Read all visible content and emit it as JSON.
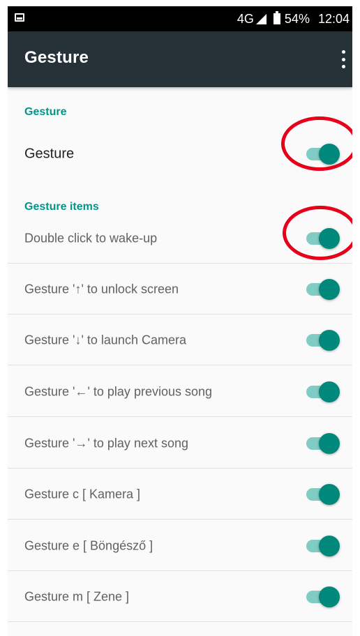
{
  "status_bar": {
    "network": "4G",
    "battery": "54%",
    "time": "12:04"
  },
  "app_bar": {
    "title": "Gesture"
  },
  "sections": {
    "gesture_header": "Gesture",
    "items_header": "Gesture items"
  },
  "rows": [
    {
      "label": "Gesture",
      "on": true
    },
    {
      "label": "Double click to wake-up",
      "on": true
    },
    {
      "label": "Gesture '↑' to unlock screen",
      "on": true
    },
    {
      "label": "Gesture '↓' to launch Camera",
      "on": true
    },
    {
      "label": "Gesture '←' to play previous song",
      "on": true
    },
    {
      "label": "Gesture '→' to play next song",
      "on": true
    },
    {
      "label": "Gesture c [ Kamera ]",
      "on": true
    },
    {
      "label": "Gesture e [ Böngésző ]",
      "on": true
    },
    {
      "label": "Gesture m [ Zene ]",
      "on": true
    }
  ],
  "colors": {
    "accent": "#009688",
    "toggle_thumb": "#00897b",
    "toggle_track": "#80cbc4",
    "app_bar": "#263238",
    "annotation": "#e6001a"
  },
  "icons": [
    "image-notification-icon",
    "signal-icon",
    "battery-icon",
    "overflow-menu-icon"
  ]
}
